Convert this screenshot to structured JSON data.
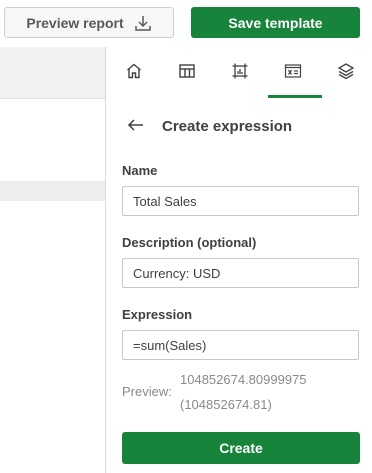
{
  "toolbar": {
    "preview_report_label": "Preview report",
    "save_template_label": "Save template"
  },
  "panel": {
    "tabs": [
      {
        "icon": "home-icon"
      },
      {
        "icon": "table-icon"
      },
      {
        "icon": "chart-frame-icon"
      },
      {
        "icon": "expression-icon",
        "active": true
      },
      {
        "icon": "layers-icon"
      }
    ],
    "title": "Create expression",
    "name": {
      "label": "Name",
      "value": "Total Sales"
    },
    "description": {
      "label": "Description (optional)",
      "value": "Currency: USD"
    },
    "expression": {
      "label": "Expression",
      "value": "=sum(Sales)"
    },
    "preview": {
      "label": "Preview:",
      "value": "104852674.80999975",
      "formatted": "(104852674.81)"
    },
    "create_label": "Create"
  },
  "colors": {
    "accent": "#18833b",
    "text": "#404040",
    "muted": "#8a8a8a"
  }
}
